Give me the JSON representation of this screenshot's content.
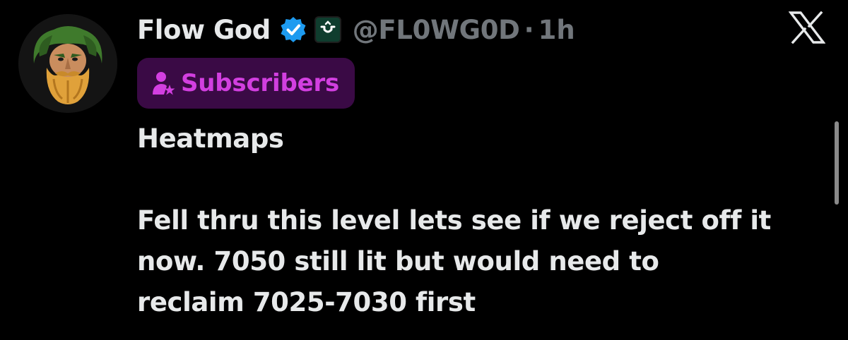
{
  "author": {
    "display_name": "Flow God",
    "handle": "@FL0WG0D",
    "separator": "·",
    "time": "1h",
    "verified": true,
    "verified_color": "#1d9bf0",
    "affiliation_badge_color": "#0f3d2e"
  },
  "badge": {
    "label": "Subscribers",
    "icon": "subscriber-person-star-icon",
    "color": "#d23fe0",
    "background": "#3a0a45"
  },
  "post": {
    "title": "Heatmaps",
    "lines": [
      "Fell thru this level lets see if we reject off it",
      "now. 7050 still lit but would need to",
      "reclaim 7025-7030 first"
    ]
  },
  "brand": {
    "logo": "x-logo-icon"
  }
}
